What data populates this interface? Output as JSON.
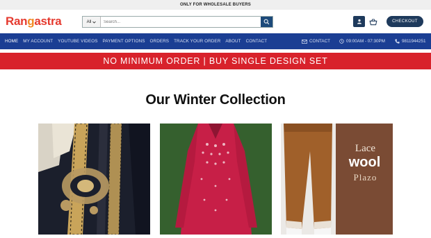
{
  "topbar": {
    "text": "ONLY FOR WHOLESALE BUYERS"
  },
  "header": {
    "logo": {
      "part1": "Ran",
      "part2": "g",
      "part3": "astra"
    },
    "search": {
      "category": "All",
      "placeholder": "Search..."
    },
    "checkout_label": "CHECKOUT"
  },
  "nav": {
    "items": [
      {
        "label": "HOME"
      },
      {
        "label": "MY ACCOUNT"
      },
      {
        "label": "YOUTUBE VIDEOS"
      },
      {
        "label": "PAYMENT OPTIONS"
      },
      {
        "label": "ORDERS"
      },
      {
        "label": "TRACK YOUR ORDER"
      },
      {
        "label": "ABOUT"
      },
      {
        "label": "CONTACT"
      }
    ],
    "contact_label": "CONTACT",
    "hours": "09:00AM - 07:30PM",
    "phone": "9811944251"
  },
  "promo": {
    "text": "NO MINIMUM ORDER | BUY SINGLE DESIGN SET"
  },
  "section": {
    "title": "Our Winter Collection"
  },
  "products": [
    {
      "overlay": ""
    },
    {
      "overlay": ""
    },
    {
      "overlay_line1": "Lace",
      "overlay_line2": "wool",
      "overlay_line3": "Plazo"
    }
  ],
  "colors": {
    "nav_bg": "#1b3e93",
    "promo_bg": "#d8222b",
    "accent_dark": "#1e3a5c",
    "logo_red": "#e53a2f"
  }
}
